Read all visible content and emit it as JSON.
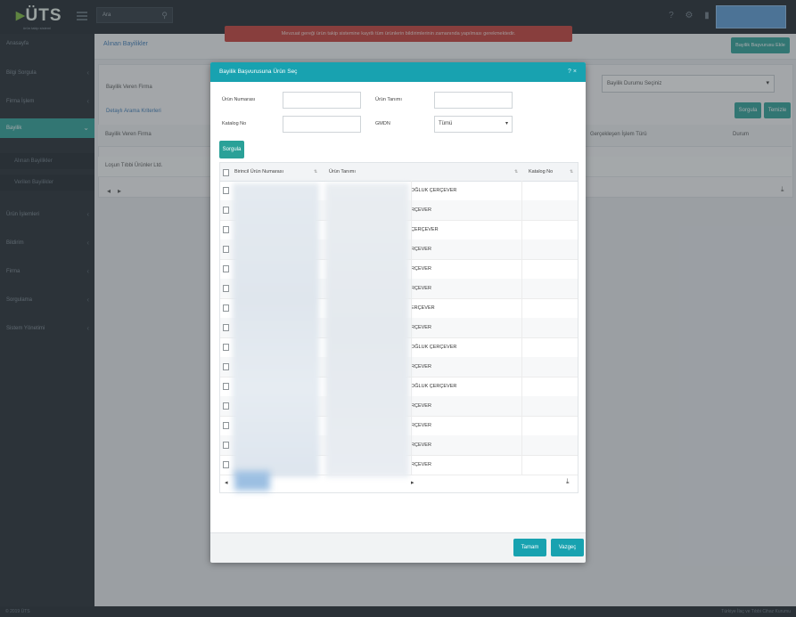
{
  "topbar": {
    "logo": "ÜTS",
    "logo_subtitle": "ürün takip sistemi",
    "search_value": "Ara"
  },
  "sidebar": {
    "items": [
      {
        "label": "Anasayfa"
      },
      {
        "label": "Bilgi Sorgula"
      },
      {
        "label": "Firma İşlem"
      },
      {
        "label": "Bayilik"
      },
      {
        "label": "Ürün İşlemleri"
      },
      {
        "label": "Bildirim"
      },
      {
        "label": "Firma"
      },
      {
        "label": "Sorgulama"
      },
      {
        "label": "Sistem Yönetimi"
      }
    ],
    "subitems": [
      {
        "label": "Alınan Bayilikler"
      },
      {
        "label": "Verilen Bayilikler"
      }
    ]
  },
  "page": {
    "breadcrumb": "Alınan Bayilikler",
    "alert": "Mevzuat gereği ürün takip sistemine kayıtlı tüm ürünlerin bildirimlerinin zamanında yapılması gerekmektedir.",
    "new_button": "Bayilik Başvurusu Ekle",
    "panel_label1": "Bayilik Veren Firma",
    "panel_link": "Detaylı Arama Kriterleri",
    "grid_col1": "Bayilik Veren Firma",
    "grid_col2": "Gerçekleşen İşlem Türü",
    "grid_col3": "Durum",
    "row1": "Loşun Tıbbi Ürünler Ltd.",
    "select_value": "Bayilik Durumu Seçiniz",
    "btn_search": "Sorgula",
    "btn_clear": "Temizle"
  },
  "modal": {
    "title": "Bayilik Başvurusuna Ürün Seç",
    "fields": {
      "product_number_label": "Ürün Numarası",
      "product_desc_label": "Ürün Tanımı",
      "catalog_label": "Katalog No",
      "type_label": "GMDN",
      "type_value": "Tümü"
    },
    "search_button": "Sorgula",
    "columns": {
      "col1": "Birincil Ürün Numarası",
      "col2": "Ürün Tanımı",
      "col3": "Katalog No"
    },
    "rows": [
      "OĞLUK ÇERÇEVER",
      "RÇEVER",
      "ÇERÇEVER",
      "RÇEVER",
      "RÇEVER",
      "RÇEVER",
      "ERÇEVER",
      "RÇEVER",
      "OĞLUK ÇERÇEVER",
      "RÇEVER",
      "OĞLUK ÇERÇEVER",
      "RÇEVER",
      "RÇEVER",
      "RÇEVER",
      "RÇEVER"
    ],
    "footer": {
      "ok_button": "Tamam",
      "cancel_button": "Vazgeç"
    }
  },
  "footer": {
    "left": "© 2019 ÜTS",
    "right": "Türkiye İlaç ve Tıbbi Cihaz Kurumu"
  }
}
